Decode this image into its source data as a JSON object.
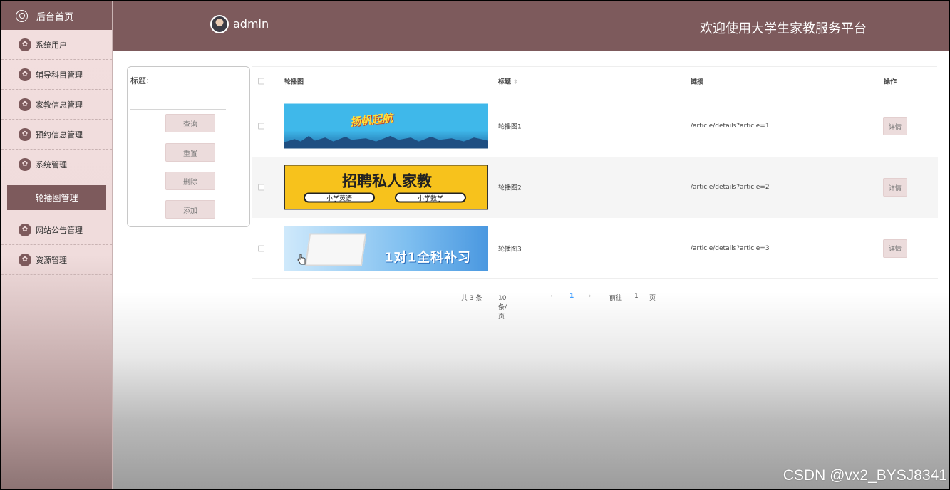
{
  "sidebar": {
    "home_label": "后台首页",
    "items": [
      {
        "label": "系统用户"
      },
      {
        "label": "辅导科目管理"
      },
      {
        "label": "家教信息管理"
      },
      {
        "label": "预约信息管理"
      },
      {
        "label": "系统管理"
      }
    ],
    "active_label": "轮播图管理",
    "items_after": [
      {
        "label": "网站公告管理"
      },
      {
        "label": "资源管理"
      }
    ]
  },
  "header": {
    "username": "admin",
    "site_title": "欢迎使用大学生家教服务平台"
  },
  "search": {
    "label": "标题:",
    "value": "",
    "buttons": {
      "query": "查询",
      "reset": "重置",
      "delete": "删除",
      "add": "添加"
    }
  },
  "table": {
    "columns": {
      "image": "轮播图",
      "title": "标题",
      "link": "链接",
      "ops": "操作"
    },
    "rows": [
      {
        "banner_text": "扬帆起航",
        "title": "轮播图1",
        "link": "/article/details?article=1",
        "action": "详情"
      },
      {
        "banner_text": "招聘私人家教",
        "banner_pills": [
          "小学英语",
          "小学数学"
        ],
        "title": "轮播图2",
        "link": "/article/details?article=2",
        "action": "详情"
      },
      {
        "banner_text": "1对1全科补习",
        "title": "轮播图3",
        "link": "/article/details?article=3",
        "action": "详情"
      }
    ]
  },
  "pagination": {
    "total": "共 3 条",
    "page_size": "10条/页",
    "prev": "‹",
    "current_page": "1",
    "next": "›",
    "goto_label": "前往",
    "goto_value": "1",
    "page_unit": "页"
  },
  "watermark": "CSDN @vx2_BYSJ8341",
  "colors": {
    "primary": "#7d5a5c",
    "sidebar_bg": "#f2dede",
    "button_bg": "#ecdcdc",
    "link_active": "#409eff"
  }
}
